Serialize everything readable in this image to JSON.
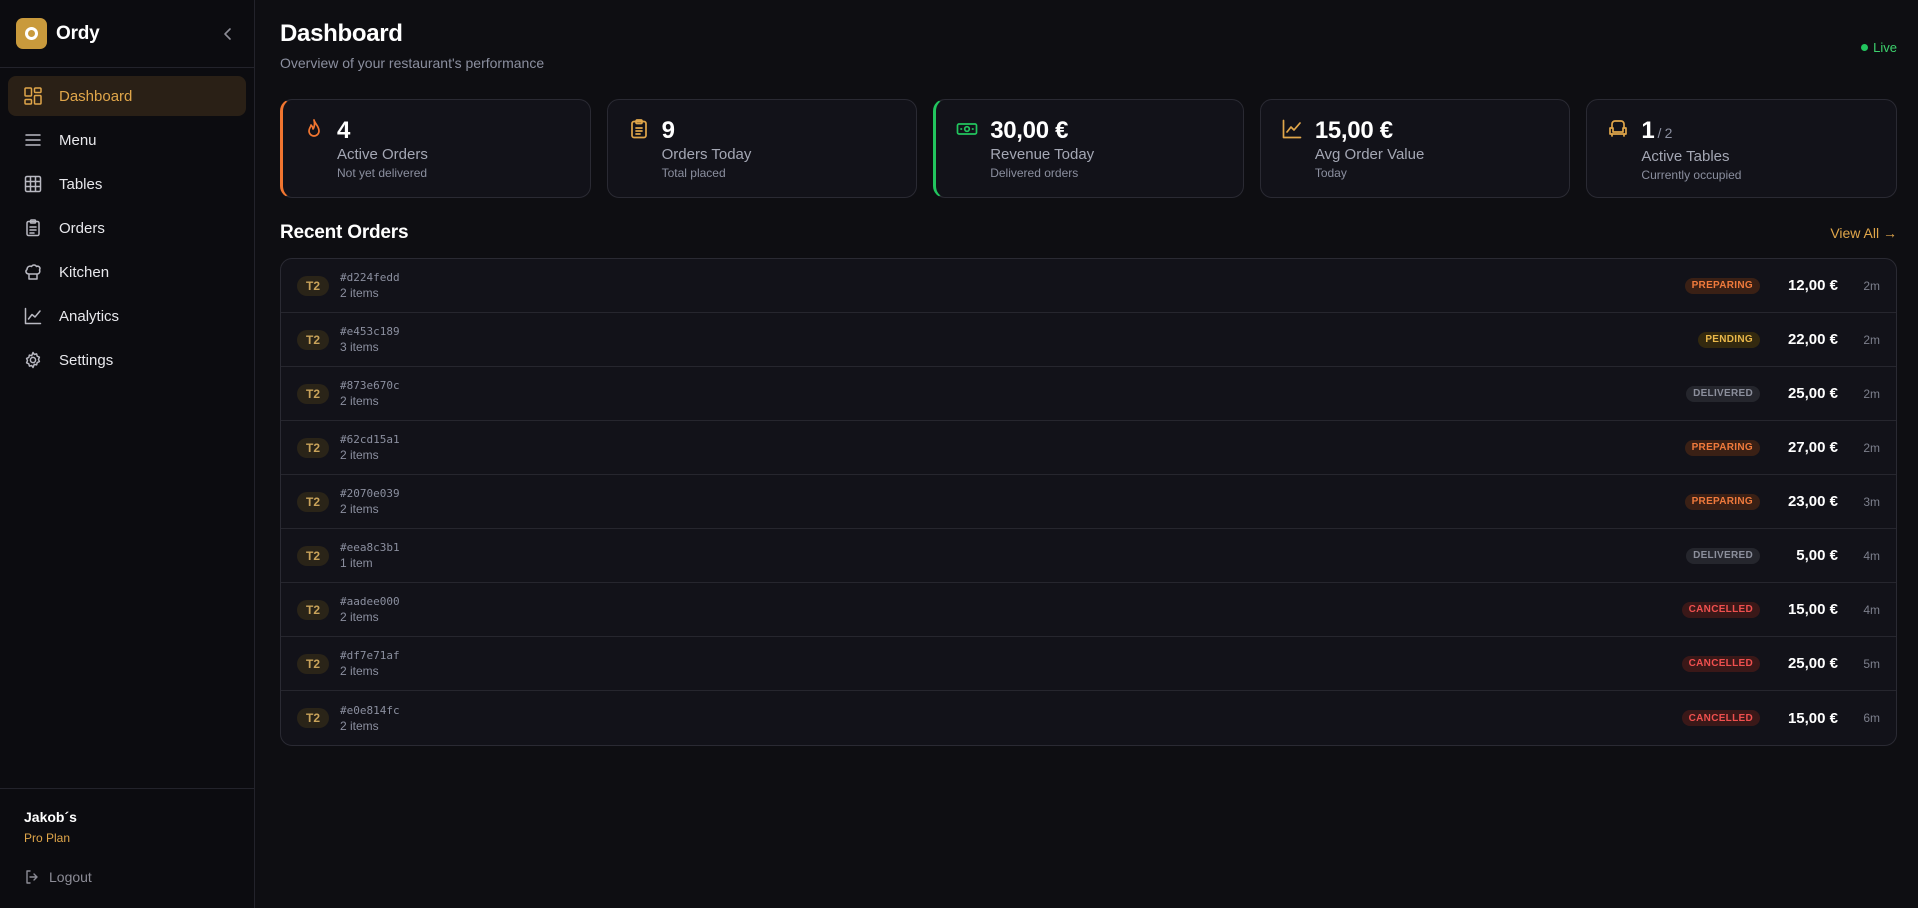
{
  "app": {
    "name": "Ordy"
  },
  "sidebar": {
    "items": [
      {
        "label": "Dashboard",
        "icon": "dashboard-icon",
        "active": true
      },
      {
        "label": "Menu",
        "icon": "menu-icon"
      },
      {
        "label": "Tables",
        "icon": "tables-icon"
      },
      {
        "label": "Orders",
        "icon": "orders-icon"
      },
      {
        "label": "Kitchen",
        "icon": "chef-hat-icon"
      },
      {
        "label": "Analytics",
        "icon": "analytics-icon"
      },
      {
        "label": "Settings",
        "icon": "gear-icon"
      }
    ],
    "user": {
      "name": "Jakob´s",
      "plan": "Pro Plan"
    },
    "logout": "Logout"
  },
  "header": {
    "title": "Dashboard",
    "subtitle": "Overview of your restaurant's performance",
    "status": "Live"
  },
  "stats": [
    {
      "value": "4",
      "label": "Active Orders",
      "sub": "Not yet delivered",
      "icon": "flame-icon",
      "color": "#f07530"
    },
    {
      "value": "9",
      "label": "Orders Today",
      "sub": "Total placed",
      "icon": "clipboard-icon",
      "color": "#e0a64a"
    },
    {
      "value": "30,00 €",
      "label": "Revenue Today",
      "sub": "Delivered orders",
      "icon": "cash-icon",
      "color": "#22c55e"
    },
    {
      "value": "15,00 €",
      "label": "Avg Order Value",
      "sub": "Today",
      "icon": "trend-icon",
      "color": "#e0a64a"
    },
    {
      "value": "1",
      "denom": "/ 2",
      "label": "Active Tables",
      "sub": "Currently occupied",
      "icon": "armchair-icon",
      "color": "#e0a64a"
    }
  ],
  "recent": {
    "title": "Recent Orders",
    "view_all": "View All →",
    "orders": [
      {
        "table": "T2",
        "id": "#d224fedd",
        "items": "2 items",
        "status": "PREPARING",
        "price": "12,00 €",
        "age": "2m"
      },
      {
        "table": "T2",
        "id": "#e453c189",
        "items": "3 items",
        "status": "PENDING",
        "price": "22,00 €",
        "age": "2m"
      },
      {
        "table": "T2",
        "id": "#873e670c",
        "items": "2 items",
        "status": "DELIVERED",
        "price": "25,00 €",
        "age": "2m"
      },
      {
        "table": "T2",
        "id": "#62cd15a1",
        "items": "2 items",
        "status": "PREPARING",
        "price": "27,00 €",
        "age": "2m"
      },
      {
        "table": "T2",
        "id": "#2070e039",
        "items": "2 items",
        "status": "PREPARING",
        "price": "23,00 €",
        "age": "3m"
      },
      {
        "table": "T2",
        "id": "#eea8c3b1",
        "items": "1 item",
        "status": "DELIVERED",
        "price": "5,00 €",
        "age": "4m"
      },
      {
        "table": "T2",
        "id": "#aadee000",
        "items": "2 items",
        "status": "CANCELLED",
        "price": "15,00 €",
        "age": "4m"
      },
      {
        "table": "T2",
        "id": "#df7e71af",
        "items": "2 items",
        "status": "CANCELLED",
        "price": "25,00 €",
        "age": "5m"
      },
      {
        "table": "T2",
        "id": "#e0e814fc",
        "items": "2 items",
        "status": "CANCELLED",
        "price": "15,00 €",
        "age": "6m"
      }
    ]
  }
}
